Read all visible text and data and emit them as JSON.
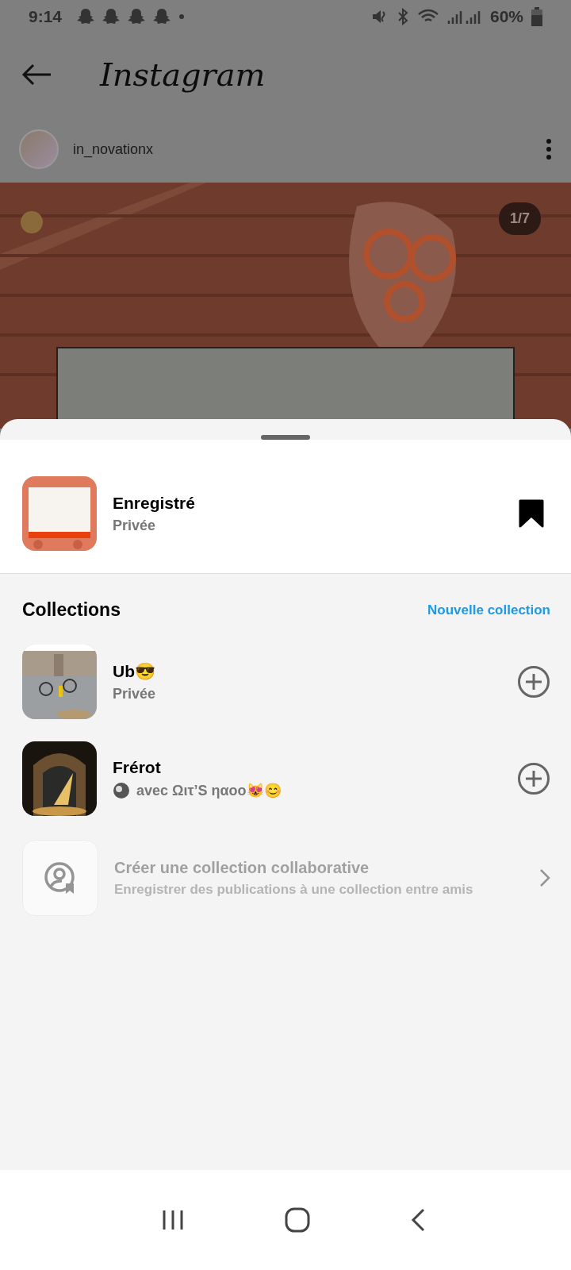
{
  "status_bar": {
    "time": "9:14",
    "battery": "60%"
  },
  "header": {
    "title": "Instagram"
  },
  "post": {
    "username": "in_novationx",
    "counter": "1/7"
  },
  "sheet": {
    "saved": {
      "title": "Enregistré",
      "subtitle": "Privée",
      "saved": true
    },
    "collections_title": "Collections",
    "new_collection": "Nouvelle collection",
    "collections": [
      {
        "kind": "collection",
        "title": "Ub😎",
        "subtitle": "Privée",
        "shared": false,
        "added": false,
        "disabled": false
      },
      {
        "kind": "collection",
        "title": "Frérot",
        "subtitle": "avec Ωιτ’S ηαοο😻😊",
        "shared": true,
        "added": false,
        "disabled": false
      },
      {
        "kind": "collaborative",
        "title": "Créer une collection collaborative",
        "subtitle": "Enregistrer des publications à une collection entre amis",
        "disabled": true
      }
    ]
  }
}
